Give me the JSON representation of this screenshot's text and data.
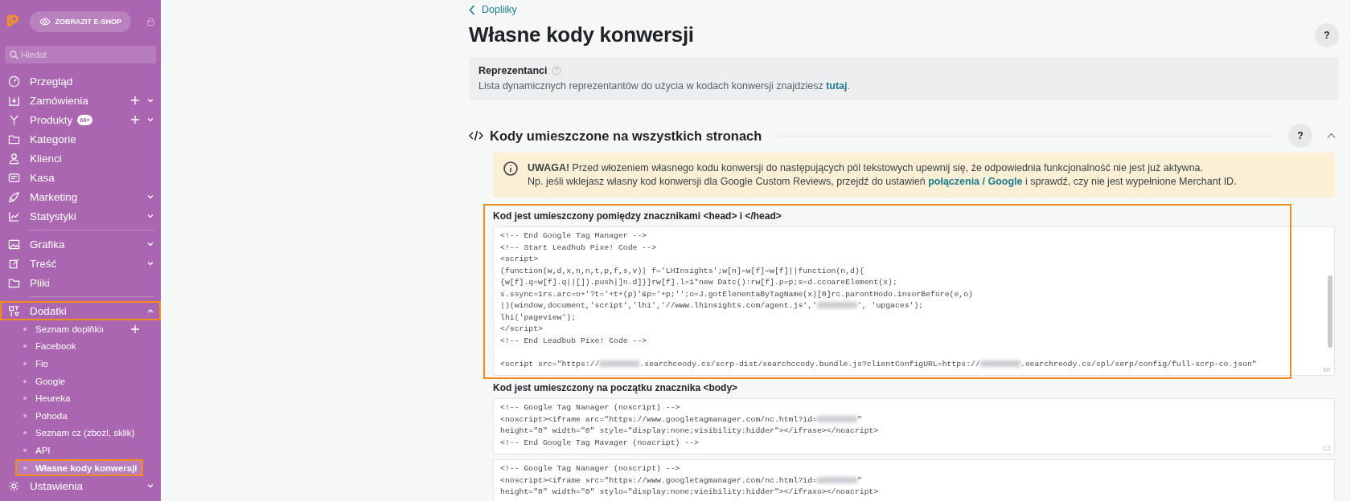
{
  "sidebar": {
    "shop_button": "ZOBRAZIT E-SHOP",
    "search": {
      "placeholder": "Hledat"
    },
    "items": [
      {
        "label": "Przegląd"
      },
      {
        "label": "Zamówienia",
        "add": true,
        "expanded": false
      },
      {
        "label": "Produkty",
        "badge": "68+",
        "add": true,
        "expanded": false
      },
      {
        "label": "Kategorie"
      },
      {
        "label": "Klienci"
      },
      {
        "label": "Kasa"
      },
      {
        "label": "Marketing",
        "expanded": false
      },
      {
        "label": "Statystyki",
        "expanded": false,
        "divider_after": true
      },
      {
        "label": "Grafika",
        "expanded": false
      },
      {
        "label": "Treść",
        "expanded": false
      },
      {
        "label": "Pliki",
        "divider_after": true
      },
      {
        "label": "Dodatki",
        "expanded": true,
        "highlighted": true,
        "children": [
          {
            "label": "Seznam doplňkiı",
            "add": true,
            "selected": false
          },
          {
            "label": "Facebook",
            "selected": false
          },
          {
            "label": "Fio",
            "selected": false
          },
          {
            "label": "Google",
            "selected": false
          },
          {
            "label": "Heureka",
            "selected": false
          },
          {
            "label": "Pohoda",
            "selected": false
          },
          {
            "label": "Seznam cz (zbozl, sklik)",
            "selected": false
          },
          {
            "label": "API",
            "selected": false
          },
          {
            "label": "Własne kody konwersji",
            "selected": true,
            "highlighted": true
          }
        ]
      },
      {
        "label": "Ustawienia",
        "expanded": false
      }
    ]
  },
  "back_link": "Dopliiky",
  "title": "Własne kody konwersji",
  "help_button": "?",
  "info_card": {
    "title": "Reprezentanci",
    "text": "Lista dynamicznych reprezentantów do użycia w kodach konwersji znajdziesz ",
    "link": "tutaj",
    "after": "."
  },
  "section": {
    "title": "Kody umieszczone na wszystkich stronach",
    "help_button": "?",
    "expanded": true,
    "warning": {
      "lead": "UWAGA!",
      "line1": "Przed włożeniem własnego kodu konwersji do następujących pól tekstowych upewnij się, że odpowiednia funkcjonalność nie jest już aktywna.",
      "line2": "Np. jeśli wklejasz własny kod konwersji dla Google Custom Reviews, przejdź do ustawień ",
      "link": "połączenia / Google",
      "line2_after": " i sprawdź, czy nie jest wypełnione Merchant ID."
    },
    "fields": [
      {
        "label": "Kod jest umieszczony pomiędzy znacznikami <head> i </head>",
        "highlighted": true,
        "counter": "6K",
        "scrollbar": true,
        "blocks": [
          {
            "lines": [
              [
                {
                  "text": "<!-- End Google Tag Manager -->"
                }
              ],
              [
                {
                  "text": "<!-- Start Leadhub Pixe! Code -->"
                }
              ],
              [
                {
                  "text": "<script>"
                }
              ],
              [
                {
                  "text": "(function(w,d,x,n,n,t,p,f,s,v)| f='LHInsights';w[n]=w[f]=w[f]||function(n,d){"
                }
              ],
              [
                {
                  "text": "{w[f].q=w[f].q||[]).push|]n.d]}]rw[f].l=1*new Datc():rw[f].p=p;s=d.ccoareElement(x);"
                }
              ],
              [
                {
                  "text": "s.ssync=1rs.arc=o+'?t='+t+(p)'&p='+p;'';o=J.gotElenentaByTagName(x)[0]rc.parontHodo.insorBefore(e,o)"
                }
              ],
              [
                {
                  "text": "|)(window,document,'script','lhi','//www.lhinsights.com/agent.js','"
                },
                {
                  "kind": "redacted"
                },
                {
                  "text": "', 'upgaces');"
                }
              ],
              [
                {
                  "text": "lhi('pageview');"
                }
              ],
              [
                {
                  "text": "</script>"
                }
              ],
              [
                {
                  "text": "<!-- End Leadbub Pixe! Code -->"
                }
              ],
              [
                {
                  "kind": "blank"
                }
              ],
              [
                {
                  "text": "<script src=\"https://"
                },
                {
                  "kind": "redacted"
                },
                {
                  "text": ".searchceody.cs/scrp-dist/searchccody.bundle.js?clientConfigURL=https://"
                },
                {
                  "kind": "redacted"
                },
                {
                  "text": ".searchreody.cs/spl/serp/config/full-scrp-co.json\""
                }
              ]
            ]
          }
        ]
      },
      {
        "label": "Kod jest umieszczony na początku znacznika <body>",
        "counter": "C2",
        "blocks": [
          {
            "lines": [
              [
                {
                  "text": "<!-- Google Tag Nanager (noscript) -->"
                }
              ],
              [
                {
                  "text": "<noscript><iframe arc=\"https://www.googletagmanager.com/nc.html?id="
                },
                {
                  "kind": "redacted"
                },
                {
                  "text": "\""
                }
              ],
              [
                {
                  "text": "height=\"0\" width=\"0\" style=\"display:none;visibility:hidder\"></ifrase></noacript>"
                }
              ],
              [
                {
                  "text": "<!-- End Google Tag Mavager (noacript) -->"
                }
              ]
            ]
          },
          {
            "lines": [
              [
                {
                  "text": "<!-- Google Tag Nanager (noscript) -->"
                }
              ],
              [
                {
                  "text": "<noscript><iframe src=\"https://www.googletagmanager.com/nc.html?id="
                },
                {
                  "kind": "redacted"
                },
                {
                  "text": "\""
                }
              ],
              [
                {
                  "text": "height=\"0\" width=\"0\" stylo=\"display:none;vieibility:hidder\"></ifraxo></noacript>"
                }
              ]
            ]
          }
        ]
      }
    ]
  }
}
